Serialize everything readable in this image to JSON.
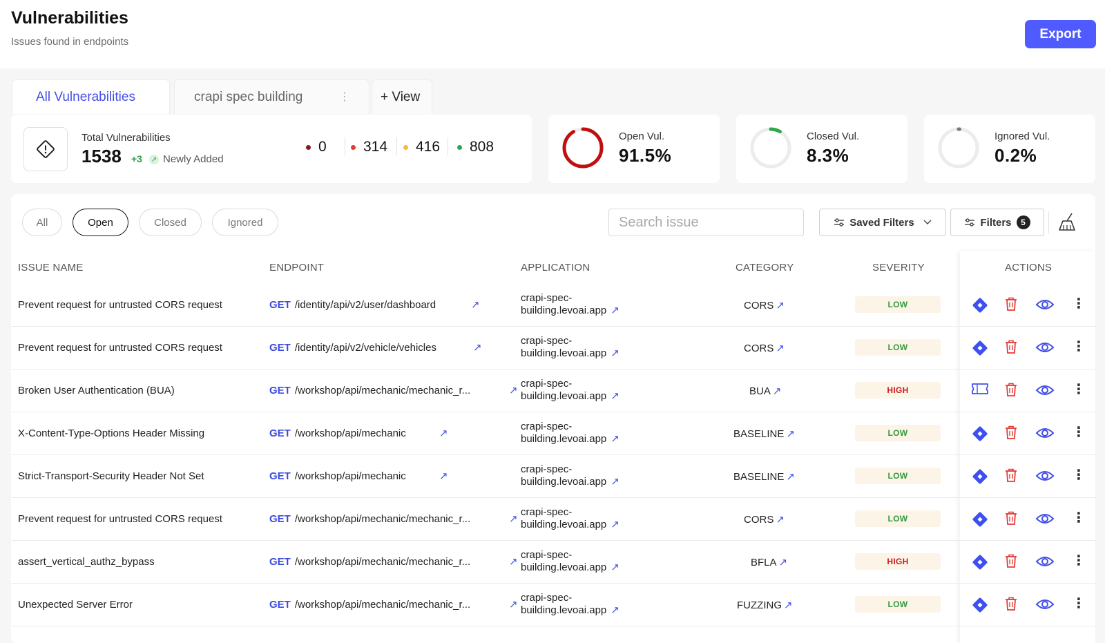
{
  "header": {
    "title": "Vulnerabilities",
    "subtitle": "Issues found in endpoints",
    "export_label": "Export"
  },
  "tabs": [
    {
      "label": "All Vulnerabilities",
      "active": true
    },
    {
      "label": "crapi spec building",
      "active": false
    },
    {
      "label": "+ View",
      "active": false
    }
  ],
  "summary": {
    "total_label": "Total Vulnerabilities",
    "total_value": "1538",
    "delta": "+3",
    "newly_label": "Newly Added",
    "severity_counts": [
      {
        "value": "0",
        "color": "#8b1a1a"
      },
      {
        "value": "314",
        "color": "#e53935"
      },
      {
        "value": "416",
        "color": "#f5b942"
      },
      {
        "value": "808",
        "color": "#2ea84a"
      }
    ]
  },
  "stats": [
    {
      "label": "Open Vul.",
      "value": "91.5%",
      "fraction": 0.915,
      "color": "#c00f0f"
    },
    {
      "label": "Closed Vul.",
      "value": "8.3%",
      "fraction": 0.083,
      "color": "#2ea84a"
    },
    {
      "label": "Ignored Vul.",
      "value": "0.2%",
      "fraction": 0.002,
      "color": "#777777"
    }
  ],
  "filters": {
    "status_pills": [
      {
        "label": "All",
        "active": false
      },
      {
        "label": "Open",
        "active": true
      },
      {
        "label": "Closed",
        "active": false
      },
      {
        "label": "Ignored",
        "active": false
      }
    ],
    "search_placeholder": "Search issue",
    "saved_filters_label": "Saved Filters",
    "filters_label": "Filters",
    "filters_count": "5"
  },
  "table": {
    "columns": [
      "ISSUE NAME",
      "ENDPOINT",
      "APPLICATION",
      "CATEGORY",
      "SEVERITY",
      "ACTIONS"
    ],
    "rows": [
      {
        "issue": "Prevent request for untrusted CORS request",
        "method": "GET",
        "path": "/identity/api/v2/user/dashboard",
        "app_line1": "crapi-spec-",
        "app_line2": "building.levoai.app",
        "category": "CORS",
        "severity": "LOW",
        "ticket_icon": "diamond"
      },
      {
        "issue": "Prevent request for untrusted CORS request",
        "method": "GET",
        "path": "/identity/api/v2/vehicle/vehicles",
        "app_line1": "crapi-spec-",
        "app_line2": "building.levoai.app",
        "category": "CORS",
        "severity": "LOW",
        "ticket_icon": "diamond"
      },
      {
        "issue": "Broken User Authentication (BUA)",
        "method": "GET",
        "path": "/workshop/api/mechanic/mechanic_r...",
        "app_line1": "crapi-spec-",
        "app_line2": "building.levoai.app",
        "category": "BUA",
        "severity": "HIGH",
        "ticket_icon": "ticket"
      },
      {
        "issue": "X-Content-Type-Options Header Missing",
        "method": "GET",
        "path": "/workshop/api/mechanic",
        "app_line1": "crapi-spec-",
        "app_line2": "building.levoai.app",
        "category": "BASELINE",
        "severity": "LOW",
        "ticket_icon": "diamond"
      },
      {
        "issue": "Strict-Transport-Security Header Not Set",
        "method": "GET",
        "path": "/workshop/api/mechanic",
        "app_line1": "crapi-spec-",
        "app_line2": "building.levoai.app",
        "category": "BASELINE",
        "severity": "LOW",
        "ticket_icon": "diamond"
      },
      {
        "issue": "Prevent request for untrusted CORS request",
        "method": "GET",
        "path": "/workshop/api/mechanic/mechanic_r...",
        "app_line1": "crapi-spec-",
        "app_line2": "building.levoai.app",
        "category": "CORS",
        "severity": "LOW",
        "ticket_icon": "diamond"
      },
      {
        "issue": "assert_vertical_authz_bypass",
        "method": "GET",
        "path": "/workshop/api/mechanic/mechanic_r...",
        "app_line1": "crapi-spec-",
        "app_line2": "building.levoai.app",
        "category": "BFLA",
        "severity": "HIGH",
        "ticket_icon": "diamond"
      },
      {
        "issue": "Unexpected Server Error",
        "method": "GET",
        "path": "/workshop/api/mechanic/mechanic_r...",
        "app_line1": "crapi-spec-",
        "app_line2": "building.levoai.app",
        "category": "FUZZING",
        "severity": "LOW",
        "ticket_icon": "diamond"
      }
    ]
  },
  "colors": {
    "accent": "#4f5bff",
    "link": "#4550e6",
    "delete": "#e53935"
  }
}
